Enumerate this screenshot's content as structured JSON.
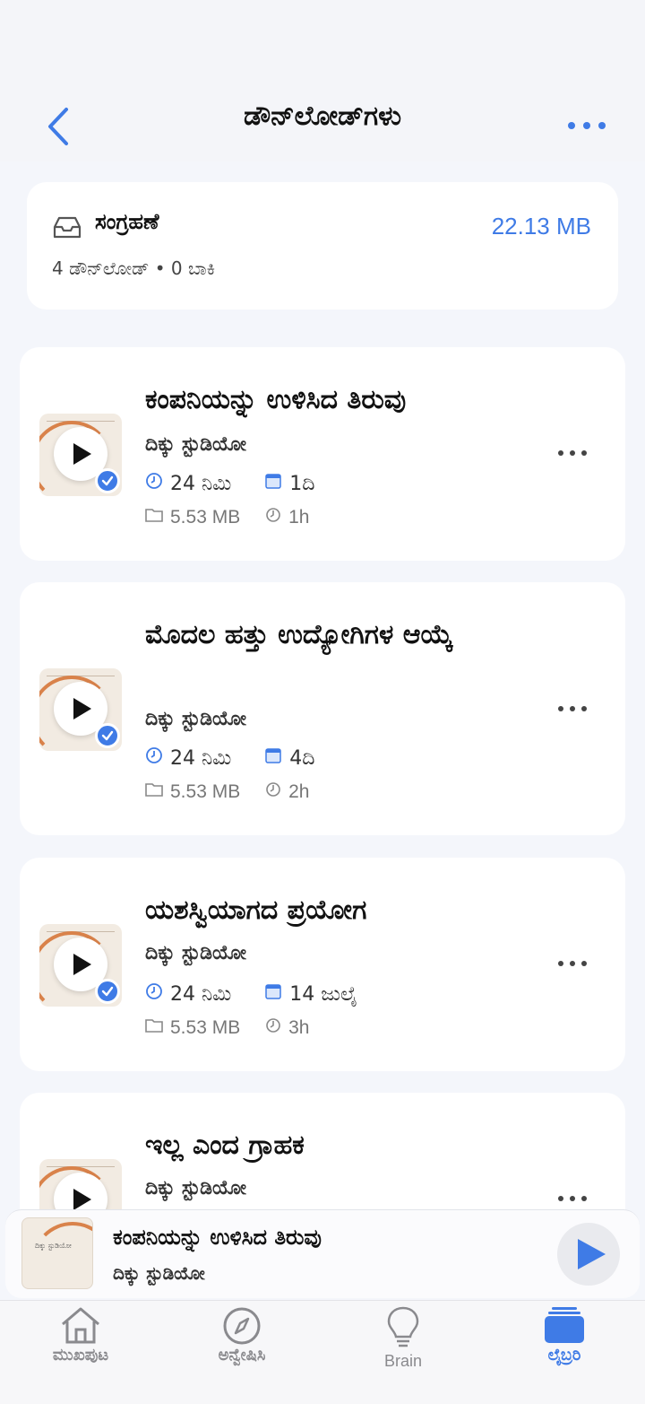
{
  "header": {
    "title": "ಡೌನ್‌ಲೋಡ್‌ಗಳು"
  },
  "summary": {
    "title": "ಸಂಗ್ರಹಣೆ",
    "subtitle": "4 ಡೌನ್‌ಲೋಡ್ • 0 ಬಾಕಿ",
    "size": "22.13 MB"
  },
  "items": [
    {
      "title": "ಕಂಪನಿಯನ್ನು ಉಳಿಸಿದ ತಿರುವು",
      "author": "ದಿಕ್ಕು ಸ್ಟುಡಿಯೋ",
      "duration": "24 ನಿಮಿ",
      "date": "1ದಿ",
      "size": "5.53 MB",
      "ago": "1h"
    },
    {
      "title": "ಮೊದಲ ಹತ್ತು ಉದ್ಯೋಗಿಗಳ ಆಯ್ಕೆ",
      "author": "ದಿಕ್ಕು ಸ್ಟುಡಿಯೋ",
      "duration": "24 ನಿಮಿ",
      "date": "4ದಿ",
      "size": "5.53 MB",
      "ago": "2h"
    },
    {
      "title": "ಯಶಸ್ವಿಯಾಗದ ಪ್ರಯೋಗ",
      "author": "ದಿಕ್ಕು ಸ್ಟುಡಿಯೋ",
      "duration": "24 ನಿಮಿ",
      "date": "14 ಜುಲೈ",
      "size": "5.53 MB",
      "ago": "3h"
    },
    {
      "title": "ಇಲ್ಲ ಎಂದ ಗ್ರಾಹಕ",
      "author": "ದಿಕ್ಕು ಸ್ಟುಡಿಯೋ"
    }
  ],
  "mini_player": {
    "title": "ಕಂಪನಿಯನ್ನು ಉಳಿಸಿದ ತಿರುವು",
    "author": "ದಿಕ್ಕು ಸ್ಟುಡಿಯೋ",
    "thumb_text": "ದಿಕ್ಕು ಸ್ಟುಡಿಯೋ"
  },
  "tabs": [
    {
      "label": "ಮುಖಪುಟ",
      "icon": "home-icon",
      "active": false
    },
    {
      "label": "ಅನ್ವೇಷಿಸಿ",
      "icon": "compass-icon",
      "active": false
    },
    {
      "label": "Brain",
      "icon": "lightbulb-icon",
      "active": false
    },
    {
      "label": "ಲೈಬ್ರರಿ",
      "icon": "library-icon",
      "active": true
    }
  ],
  "colors": {
    "accent": "#3f7be6",
    "background": "#f4f6fb",
    "thumb_arc": "#d9824a"
  }
}
